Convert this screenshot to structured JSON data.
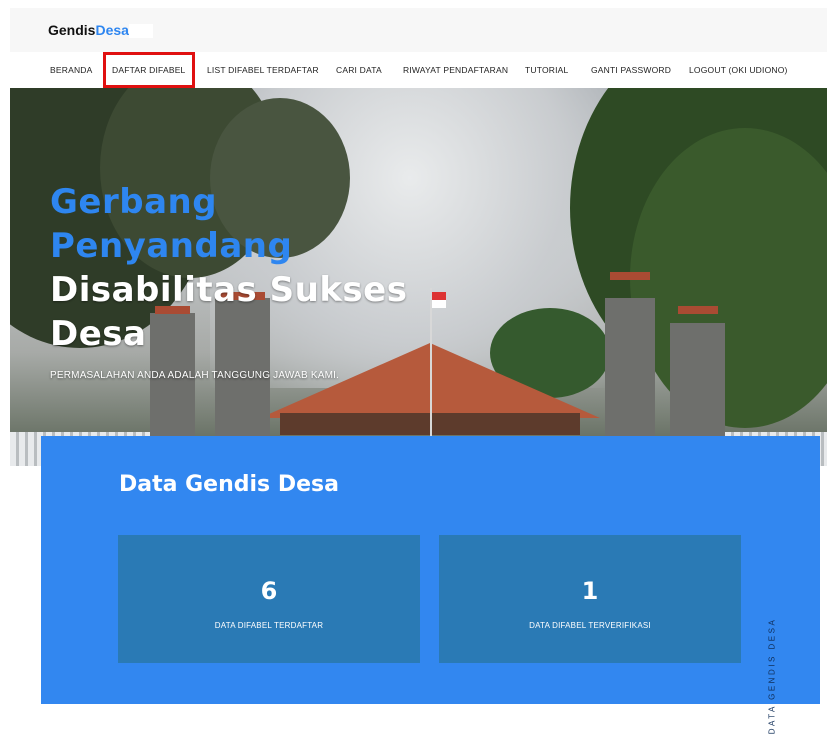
{
  "brand": {
    "name_part1": "Gendis",
    "name_part2": "Desa"
  },
  "nav": {
    "items": [
      {
        "label": "BERANDA"
      },
      {
        "label": "DAFTAR DIFABEL",
        "active": true
      },
      {
        "label": "LIST DIFABEL TERDAFTAR"
      },
      {
        "label": "CARI DATA"
      },
      {
        "label": "RIWAYAT PENDAFTARAN"
      },
      {
        "label": "TUTORIAL"
      },
      {
        "label": "GANTI PASSWORD"
      },
      {
        "label": "LOGOUT (OKI UDIONO)"
      }
    ]
  },
  "hero": {
    "title_line1": "Gerbang",
    "title_line2": "Penyandang",
    "title_line3": "Disabilitas Sukses",
    "title_line4": "Desa",
    "tagline": "PERMASALAHAN ANDA ADALAH TANGGUNG JAWAB KAMI."
  },
  "stats": {
    "title": "Data Gendis Desa",
    "side_label": "DATA GENDIS DESA",
    "cards": [
      {
        "value": "6",
        "label": "DATA DIFABEL TERDAFTAR"
      },
      {
        "value": "1",
        "label": "DATA DIFABEL TERVERIFIKASI"
      }
    ]
  },
  "colors": {
    "accent": "#2e86f0",
    "highlight": "#e01010",
    "card": "#2a7ab5"
  }
}
